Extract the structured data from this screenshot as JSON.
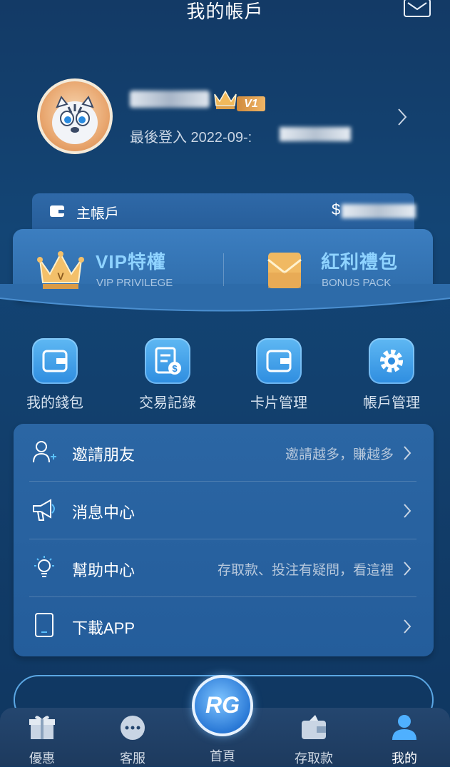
{
  "header": {
    "title": "我的帳戶"
  },
  "profile": {
    "badge": "V1",
    "last_login_prefix": "最後登入 2022-09-:"
  },
  "account": {
    "label": "主帳戶",
    "currency": "$"
  },
  "promo": {
    "vip": {
      "title": "VIP特權",
      "subtitle": "VIP PRIVILEGE"
    },
    "bonus": {
      "title": "紅利禮包",
      "subtitle": "BONUS PACK"
    }
  },
  "quick_actions": [
    {
      "label": "我的錢包"
    },
    {
      "label": "交易記錄"
    },
    {
      "label": "卡片管理"
    },
    {
      "label": "帳戶管理"
    }
  ],
  "menu": [
    {
      "title": "邀請朋友",
      "hint": "邀請越多，賺越多"
    },
    {
      "title": "消息中心",
      "hint": ""
    },
    {
      "title": "幫助中心",
      "hint": "存取款、投注有疑問，看這裡"
    },
    {
      "title": "下載APP",
      "hint": ""
    }
  ],
  "tabbar": {
    "items": [
      {
        "label": "優惠"
      },
      {
        "label": "客服"
      },
      {
        "label": "首頁"
      },
      {
        "label": "存取款"
      },
      {
        "label": "我的"
      }
    ],
    "center_logo": "RG",
    "active": "我的"
  }
}
